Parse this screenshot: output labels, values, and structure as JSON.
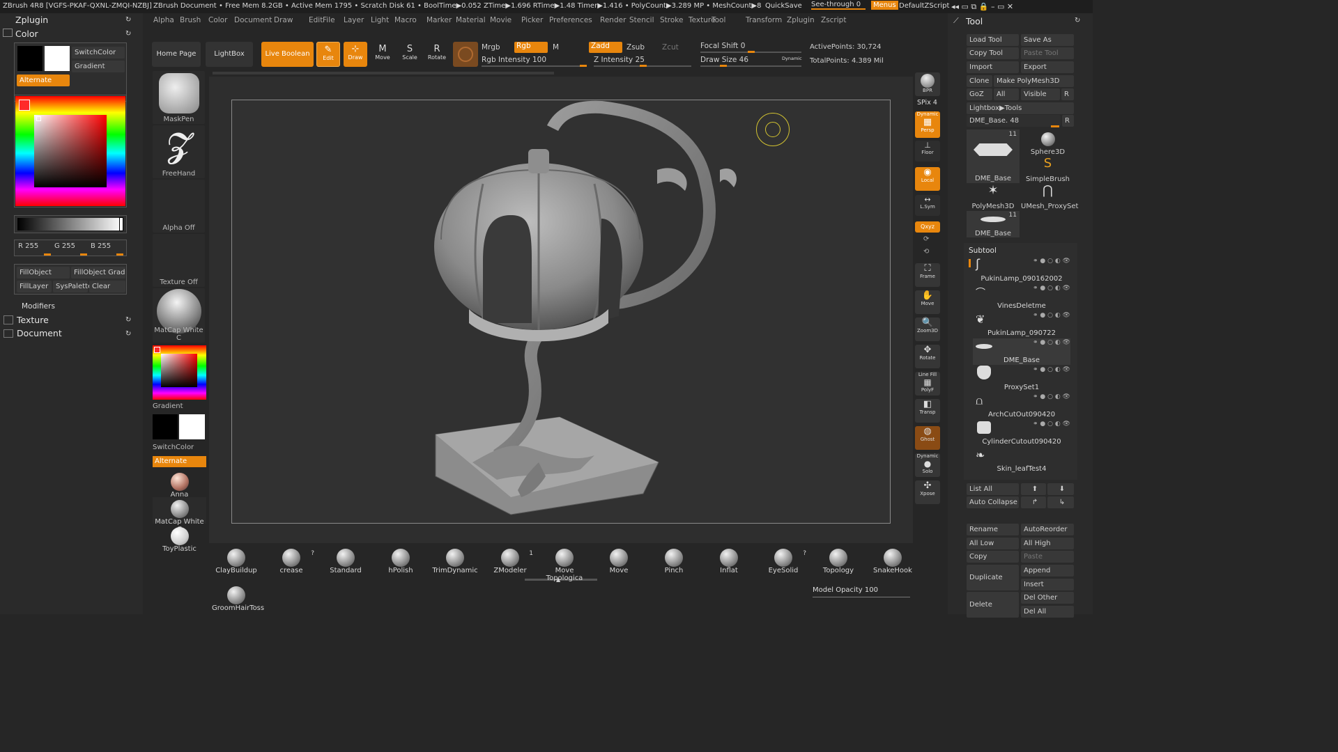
{
  "titlebar": {
    "app": "ZBrush 4R8 [VGFS-PKAF-QXNL-ZMQI-NZBJ]",
    "doc": "ZBrush Document",
    "stats": "• Free Mem 8.2GB • Active Mem 1795 • Scratch Disk 61 •  BoolTime▶0.052 ZTime▶1.696 RTime▶1.48 Timer▶1.416 • PolyCount▶3.289 MP  • MeshCount▶8",
    "quicksave": "QuickSave",
    "seethrough": "See-through  0",
    "menus": "Menus",
    "script": "DefaultZScript"
  },
  "menu": [
    "Alpha",
    "Brush",
    "Color",
    "Document",
    "Draw",
    "Edit",
    "File",
    "Layer",
    "Light",
    "Macro",
    "Marker",
    "Material",
    "Movie",
    "Picker",
    "Preferences",
    "Render",
    "Stencil",
    "Stroke",
    "Texture",
    "Tool",
    "Transform",
    "Zplugin",
    "Zscript"
  ],
  "left": {
    "zplugin": "Zplugin",
    "color": "Color",
    "switchcolor": "SwitchColor",
    "gradient": "Gradient",
    "alternate": "Alternate",
    "r": "R 255",
    "g": "G 255",
    "b": "B 255",
    "fillobject": "FillObject",
    "fillobjectgrad": "FillObject Grad",
    "filllayer": "FillLayer",
    "syspalette": "SysPalette",
    "clear": "Clear",
    "modifiers": "Modifiers",
    "texture": "Texture",
    "document": "Document",
    "main_color": "#ff2a2a"
  },
  "shelf": {
    "homepage": "Home Page",
    "lightbox": "LightBox",
    "liveboolean": "Live Boolean",
    "edit": "Edit",
    "draw": "Draw",
    "move": "Move",
    "scale": "Scale",
    "rotate": "Rotate",
    "mrgb": "Mrgb",
    "rgb": "Rgb",
    "m": "M",
    "rgbintensity": "Rgb Intensity 100",
    "zadd": "Zadd",
    "zsub": "Zsub",
    "zcut": "Zcut",
    "zintensity": "Z Intensity 25",
    "focalshift": "Focal Shift 0",
    "drawsize": "Draw Size 46",
    "dynamic": "Dynamic",
    "activepoints": "ActivePoints: 30,724",
    "totalpoints": "TotalPoints: 4.389 Mil"
  },
  "leftbar": {
    "maskpen": "MaskPen",
    "freehand": "FreeHand",
    "alphaoff": "Alpha Off",
    "textureoff": "Texture Off",
    "matcap": "MatCap White C",
    "gradient": "Gradient",
    "switchcolor": "SwitchColor",
    "alternate": "Alternate",
    "anna": "Anna",
    "matcap2": "MatCap White C",
    "toyplastic": "ToyPlastic"
  },
  "rightstrip": {
    "bpr": "BPR",
    "spix": "SPix 4",
    "dynamic": "Dynamic",
    "persp": "Persp",
    "floor": "Floor",
    "local": "Local",
    "lsym": "L.Sym",
    "xyz": "Qxyz",
    "frame": "Frame",
    "move": "Move",
    "zoom3d": "Zoom3D",
    "rotate": "Rotate",
    "linefill": "Line Fill",
    "polyf": "PolyF",
    "transp": "Transp",
    "ghost": "Ghost",
    "dynamic2": "Dynamic",
    "solo": "Solo",
    "xpose": "Xpose"
  },
  "tool": {
    "title": "Tool",
    "loadtool": "Load Tool",
    "saveas": "Save As",
    "copytool": "Copy Tool",
    "pastetool": "Paste Tool",
    "import": "Import",
    "export": "Export",
    "clone": "Clone",
    "makepoly": "Make PolyMesh3D",
    "goz": "GoZ",
    "all": "All",
    "visible": "Visible",
    "r": "R",
    "lightboxtools": "Lightbox▶Tools",
    "dmebase": "DME_Base. 48",
    "thumbs": [
      {
        "name": "DME_Base",
        "count": "11"
      },
      {
        "name": "Sphere3D",
        "count": ""
      },
      {
        "name": "SimpleBrush",
        "count": ""
      },
      {
        "name": "PolyMesh3D",
        "count": ""
      },
      {
        "name": "UMesh_ProxySet",
        "count": ""
      },
      {
        "name": "DME_Base",
        "count": "11"
      }
    ],
    "subtool": "Subtool",
    "subtools": [
      "PukinLamp_090162002",
      "VinesDeletme",
      "PukinLamp_090722",
      "DME_Base",
      "ProxySet1",
      "ArchCutOut090420",
      "CylinderCutout090420",
      "Skin_leafTest4"
    ],
    "listall": "List All",
    "autocollapse": "Auto Collapse",
    "rename": "Rename",
    "autoreorder": "AutoReorder",
    "alllow": "All Low",
    "allhigh": "All High",
    "copy": "Copy",
    "paste": "Paste",
    "duplicate": "Duplicate",
    "append": "Append",
    "insert": "Insert",
    "delete": "Delete",
    "delother": "Del Other",
    "delall": "Del All"
  },
  "brushes": [
    {
      "name": "ClayBuildup",
      "badge": ""
    },
    {
      "name": "crease",
      "badge": "?"
    },
    {
      "name": "Standard",
      "badge": ""
    },
    {
      "name": "hPolish",
      "badge": ""
    },
    {
      "name": "TrimDynamic",
      "badge": ""
    },
    {
      "name": "ZModeler",
      "badge": "1"
    },
    {
      "name": "Move Topologica",
      "badge": ""
    },
    {
      "name": "Move",
      "badge": ""
    },
    {
      "name": "Pinch",
      "badge": ""
    },
    {
      "name": "Inflat",
      "badge": ""
    },
    {
      "name": "EyeSolid",
      "badge": "?"
    },
    {
      "name": "Topology",
      "badge": ""
    },
    {
      "name": "SnakeHook",
      "badge": ""
    },
    {
      "name": "GroomHairToss",
      "badge": ""
    }
  ],
  "modelopacity": "Model Opacity 100"
}
